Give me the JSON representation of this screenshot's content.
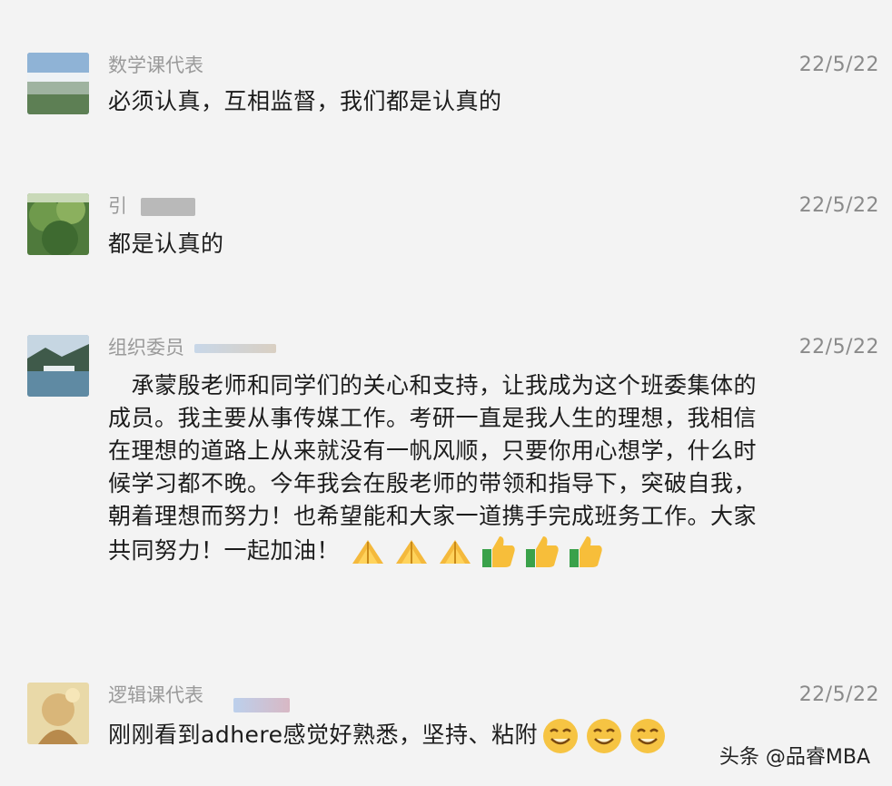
{
  "messages": [
    {
      "name": "数学课代表",
      "date": "22/5/22",
      "text": "必须认真，互相监督，我们都是认真的"
    },
    {
      "name": "引",
      "date": "22/5/22",
      "text": "都是认真的"
    },
    {
      "name": "组织委员",
      "date": "22/5/22",
      "text": "　承蒙殷老师和同学们的关心和支持，让我成为这个班委集体的成员。我主要从事传媒工作。考研一直是我人生的理想，我相信在理想的道路上从来就没有一帆风顺，只要你用心想学，什么时候学习都不晚。今年我会在殷老师的带领和指导下，突破自我，朝着理想而努力！也希望能和大家一道携手完成班务工作。大家共同努力！一起加油！",
      "emojis": [
        "pray-icon",
        "pray-icon",
        "pray-icon",
        "thumbs-up-icon",
        "thumbs-up-icon",
        "thumbs-up-icon"
      ]
    },
    {
      "name": "逻辑课代表",
      "date": "22/5/22",
      "text": "刚刚看到adhere感觉好熟悉，坚持、粘附",
      "emojis": [
        "grin-icon",
        "grin-icon",
        "grin-icon"
      ]
    }
  ],
  "watermark": "头条 @品睿MBA",
  "colors": {
    "background": "#f3f3f3",
    "name": "#9a9a9a",
    "date": "#8a8a8a",
    "text": "#1c1c1c"
  }
}
